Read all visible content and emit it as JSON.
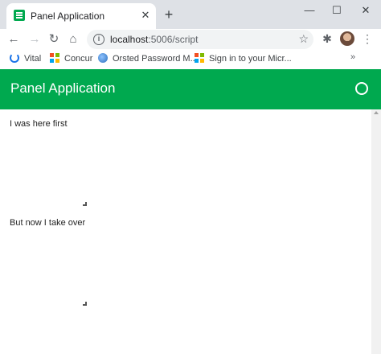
{
  "browser": {
    "tab": {
      "title": "Panel Application",
      "close_label": "✕",
      "favicon": "panel-icon"
    },
    "new_tab_label": "+",
    "window_controls": {
      "minimize": "—",
      "maximize": "☐",
      "close": "✕"
    },
    "toolbar": {
      "back": "←",
      "forward": "→",
      "reload": "↻",
      "home": "⌂",
      "url_host": "localhost",
      "url_path": ":5006/script",
      "star": "☆",
      "extensions": "✱",
      "menu": "⋮"
    },
    "bookmarks": [
      {
        "label": "Vital",
        "icon": "power-icon"
      },
      {
        "label": "Concur",
        "icon": "microsoft-icon"
      },
      {
        "label": "Orsted Password M...",
        "icon": "globe-icon"
      },
      {
        "label": "Sign in to your Micr...",
        "icon": "microsoft-icon"
      }
    ],
    "bookmarks_more": "»"
  },
  "app": {
    "title": "Panel Application",
    "accent_color": "#00a94f",
    "panes": [
      {
        "text": "I was here first"
      },
      {
        "text": "But now I take over"
      }
    ]
  }
}
